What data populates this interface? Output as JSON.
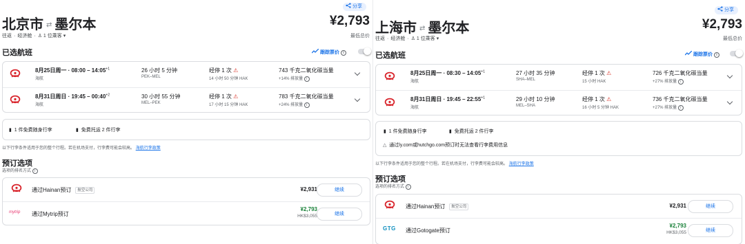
{
  "left": {
    "share": "分享",
    "origin": "北京市",
    "destination": "墨尔本",
    "price": "¥2,793",
    "price_note": "最低总价",
    "trip_type": "往返",
    "cabin": "经济舱",
    "passengers": "1 位乘客",
    "selected_title": "已选航班",
    "track_label": "跟踪票价",
    "flights": [
      {
        "time": "8月25日周一 · 08:00 – 14:05",
        "sup": "+1",
        "airline": "海航",
        "duration": "26 小时 5 分钟",
        "route": "PEK–MEL",
        "stops": "经停 1 次",
        "layover": "14 小时 50 分钟 HAK",
        "co2": "743 千克二氧化碳当量",
        "co2_sub": "+14% 排放量"
      },
      {
        "time": "8月31日周日 · 19:45 – 00:40",
        "sup": "+2",
        "airline": "海航",
        "duration": "30 小时 55 分钟",
        "route": "MEL–PEK",
        "stops": "经停 1 次",
        "layover": "17 小时 15 分钟 HAK",
        "co2": "783 千克二氧化碳当量",
        "co2_sub": "+24% 排放量"
      }
    ],
    "baggage": [
      "1 件免费随身行李",
      "免费托运 2 件行李"
    ],
    "bag_note": "以下行李条件适用于您的整个行程。若在机场支付，行李费可能会较高。",
    "bag_link": "海航行李政策",
    "booking_title": "预订选项",
    "booking_sub": "选项的排名方式",
    "options": [
      {
        "label": "通过Hainan预订",
        "tag": "航空公司",
        "price": "¥2,931",
        "alt": "",
        "button": "继续",
        "logo": "hainan-airlines-logo"
      },
      {
        "label": "通过Mytrip预订",
        "tag": "",
        "price": "¥2,793",
        "alt": "HK$3,055",
        "button": "继续",
        "logo": "mytrip"
      }
    ]
  },
  "right": {
    "share": "分享",
    "origin": "上海市",
    "destination": "墨尔本",
    "price": "¥2,793",
    "price_note": "最低总价",
    "trip_type": "往返",
    "cabin": "经济舱",
    "passengers": "1 位乘客",
    "selected_title": "已选航班",
    "track_label": "跟踪票价",
    "flights": [
      {
        "time": "8月25日周一 · 08:30 – 14:05",
        "sup": "+1",
        "airline": "海航",
        "duration": "27 小时 35 分钟",
        "route": "SHA–MEL",
        "stops": "经停 1 次",
        "layover": "15 小时 HAK",
        "co2": "726 千克二氧化碳当量",
        "co2_sub": "+27% 排放量"
      },
      {
        "time": "8月31日周日 · 19:45 – 22:55",
        "sup": "+1",
        "airline": "海航",
        "duration": "29 小时 10 分钟",
        "route": "MEL–SHA",
        "stops": "经停 1 次",
        "layover": "16 小时 5 分钟 HAK",
        "co2": "736 千克二氧化碳当量",
        "co2_sub": "+27% 排放量"
      }
    ],
    "baggage": [
      "1 件免费随身行李",
      "免费托运 2 件行李"
    ],
    "warning": "通过ly.com或hutchgo.com预订时无法查看行李费用信息",
    "bag_note": "以下行李条件适用于您的整个行程。若在机场支付，行李费可能会较高。",
    "bag_link": "海航行李政策",
    "booking_title": "预订选项",
    "booking_sub": "选项的排名方式",
    "options": [
      {
        "label": "通过Hainan预订",
        "tag": "航空公司",
        "price": "¥2,931",
        "alt": "",
        "button": "继续",
        "logo": "hainan-airlines-logo"
      },
      {
        "label": "通过Gotogate预订",
        "tag": "",
        "price": "¥2,793",
        "alt": "HK$3,055",
        "button": "继续",
        "logo": "GTG"
      }
    ]
  },
  "colors": {
    "accent": "#1a73e8",
    "green": "#188038",
    "warning": "#d93025",
    "hainan_red": "#d8232a"
  },
  "logo_text": {
    "mytrip": "mytrip",
    "gotogate": "GTG"
  }
}
